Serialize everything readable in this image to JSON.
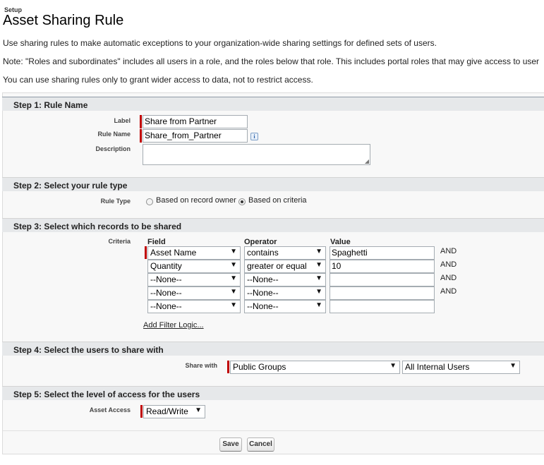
{
  "header": {
    "breadcrumb": "Setup",
    "title": "Asset Sharing Rule"
  },
  "intro": {
    "line1": "Use sharing rules to make automatic exceptions to your organization-wide sharing settings for defined sets of users.",
    "line2": "Note: \"Roles and subordinates\" includes all users in a role, and the roles below that role. This includes portal roles that may give access to user",
    "line3": "You can use sharing rules only to grant wider access to data, not to restrict access."
  },
  "step1": {
    "title": "Step 1: Rule Name",
    "label_label": "Label",
    "label_value": "Share from Partner",
    "rule_name_label": "Rule Name",
    "rule_name_value": "Share_from_Partner",
    "info_icon": "info-icon",
    "description_label": "Description",
    "description_value": ""
  },
  "step2": {
    "title": "Step 2: Select your rule type",
    "rule_type_label": "Rule Type",
    "option_owner": "Based on record owner",
    "option_criteria": "Based on criteria",
    "selected": "Based on criteria"
  },
  "step3": {
    "title": "Step 3: Select which records to be shared",
    "criteria_label": "Criteria",
    "col_field": "Field",
    "col_operator": "Operator",
    "col_value": "Value",
    "rows": [
      {
        "field": "Asset Name",
        "operator": "contains",
        "value": "Spaghetti",
        "conj": "AND"
      },
      {
        "field": "Quantity",
        "operator": "greater or equal",
        "value": "10",
        "conj": "AND"
      },
      {
        "field": "--None--",
        "operator": "--None--",
        "value": "",
        "conj": "AND"
      },
      {
        "field": "--None--",
        "operator": "--None--",
        "value": "",
        "conj": "AND"
      },
      {
        "field": "--None--",
        "operator": "--None--",
        "value": "",
        "conj": ""
      }
    ],
    "add_filter_logic": "Add Filter Logic..."
  },
  "step4": {
    "title": "Step 4: Select the users to share with",
    "share_with_label": "Share with",
    "share_type": "Public Groups",
    "share_target": "All Internal Users"
  },
  "step5": {
    "title": "Step 5: Select the level of access for the users",
    "asset_access_label": "Asset Access",
    "asset_access_value": "Read/Write"
  },
  "buttons": {
    "save": "Save",
    "cancel": "Cancel"
  },
  "colors": {
    "required_bar": "#c00000",
    "header_bg": "#e6e8ea",
    "panel_bg": "#f8f8f8"
  }
}
